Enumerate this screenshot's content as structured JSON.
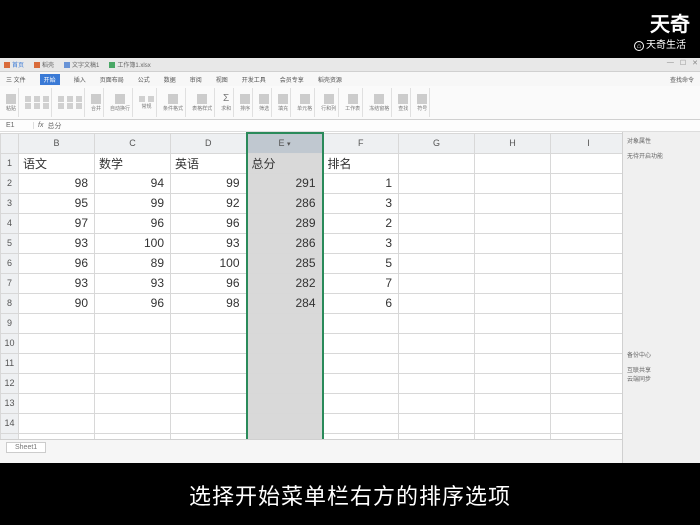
{
  "watermark": {
    "main": "天奇",
    "sub": "天奇生活"
  },
  "subtitle": "选择开始菜单栏右方的排序选项",
  "tabs": [
    {
      "label": "首页"
    },
    {
      "label": "稻壳"
    },
    {
      "label": "文字文稿1"
    },
    {
      "label": "工作簿1.xlsx"
    }
  ],
  "menu": {
    "items": [
      "三 文件",
      "开始",
      "插入",
      "页面布局",
      "公式",
      "数据",
      "审阅",
      "视图",
      "开发工具",
      "会员专享",
      "稻壳资源"
    ],
    "search": "查找命令"
  },
  "namebox": "E1",
  "fx_label": "fx",
  "formula": "总分",
  "rightpanel": {
    "title": "对象属性",
    "sub": "无待开启功能"
  },
  "bottom_panel": {
    "title": "备份中心",
    "items": [
      "互联共享",
      "云端同步"
    ]
  },
  "sheet_tab": "Sheet1",
  "columns": [
    "B",
    "C",
    "D",
    "E",
    "F",
    "G",
    "H",
    "I"
  ],
  "headers": [
    "语文",
    "数学",
    "英语",
    "总分",
    "排名"
  ],
  "rows": [
    {
      "b": 98,
      "c": 94,
      "d": 99,
      "e": 291,
      "f": 1
    },
    {
      "b": 95,
      "c": 99,
      "d": 92,
      "e": 286,
      "f": 3
    },
    {
      "b": 97,
      "c": 96,
      "d": 96,
      "e": 289,
      "f": 2
    },
    {
      "b": 93,
      "c": 100,
      "d": 93,
      "e": 286,
      "f": 3
    },
    {
      "b": 96,
      "c": 89,
      "d": 100,
      "e": 285,
      "f": 5
    },
    {
      "b": 93,
      "c": 93,
      "d": 96,
      "e": 282,
      "f": 7
    },
    {
      "b": 90,
      "c": 96,
      "d": 98,
      "e": 284,
      "f": 6
    }
  ]
}
